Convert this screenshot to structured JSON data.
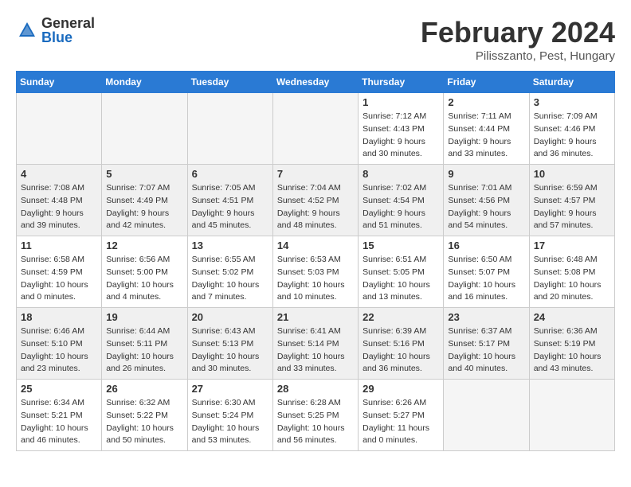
{
  "header": {
    "logo": {
      "general": "General",
      "blue": "Blue"
    },
    "title": "February 2024",
    "location": "Pilisszanto, Pest, Hungary"
  },
  "days_of_week": [
    "Sunday",
    "Monday",
    "Tuesday",
    "Wednesday",
    "Thursday",
    "Friday",
    "Saturday"
  ],
  "weeks": [
    [
      {
        "day": "",
        "info": ""
      },
      {
        "day": "",
        "info": ""
      },
      {
        "day": "",
        "info": ""
      },
      {
        "day": "",
        "info": ""
      },
      {
        "day": "1",
        "info": "Sunrise: 7:12 AM\nSunset: 4:43 PM\nDaylight: 9 hours\nand 30 minutes."
      },
      {
        "day": "2",
        "info": "Sunrise: 7:11 AM\nSunset: 4:44 PM\nDaylight: 9 hours\nand 33 minutes."
      },
      {
        "day": "3",
        "info": "Sunrise: 7:09 AM\nSunset: 4:46 PM\nDaylight: 9 hours\nand 36 minutes."
      }
    ],
    [
      {
        "day": "4",
        "info": "Sunrise: 7:08 AM\nSunset: 4:48 PM\nDaylight: 9 hours\nand 39 minutes."
      },
      {
        "day": "5",
        "info": "Sunrise: 7:07 AM\nSunset: 4:49 PM\nDaylight: 9 hours\nand 42 minutes."
      },
      {
        "day": "6",
        "info": "Sunrise: 7:05 AM\nSunset: 4:51 PM\nDaylight: 9 hours\nand 45 minutes."
      },
      {
        "day": "7",
        "info": "Sunrise: 7:04 AM\nSunset: 4:52 PM\nDaylight: 9 hours\nand 48 minutes."
      },
      {
        "day": "8",
        "info": "Sunrise: 7:02 AM\nSunset: 4:54 PM\nDaylight: 9 hours\nand 51 minutes."
      },
      {
        "day": "9",
        "info": "Sunrise: 7:01 AM\nSunset: 4:56 PM\nDaylight: 9 hours\nand 54 minutes."
      },
      {
        "day": "10",
        "info": "Sunrise: 6:59 AM\nSunset: 4:57 PM\nDaylight: 9 hours\nand 57 minutes."
      }
    ],
    [
      {
        "day": "11",
        "info": "Sunrise: 6:58 AM\nSunset: 4:59 PM\nDaylight: 10 hours\nand 0 minutes."
      },
      {
        "day": "12",
        "info": "Sunrise: 6:56 AM\nSunset: 5:00 PM\nDaylight: 10 hours\nand 4 minutes."
      },
      {
        "day": "13",
        "info": "Sunrise: 6:55 AM\nSunset: 5:02 PM\nDaylight: 10 hours\nand 7 minutes."
      },
      {
        "day": "14",
        "info": "Sunrise: 6:53 AM\nSunset: 5:03 PM\nDaylight: 10 hours\nand 10 minutes."
      },
      {
        "day": "15",
        "info": "Sunrise: 6:51 AM\nSunset: 5:05 PM\nDaylight: 10 hours\nand 13 minutes."
      },
      {
        "day": "16",
        "info": "Sunrise: 6:50 AM\nSunset: 5:07 PM\nDaylight: 10 hours\nand 16 minutes."
      },
      {
        "day": "17",
        "info": "Sunrise: 6:48 AM\nSunset: 5:08 PM\nDaylight: 10 hours\nand 20 minutes."
      }
    ],
    [
      {
        "day": "18",
        "info": "Sunrise: 6:46 AM\nSunset: 5:10 PM\nDaylight: 10 hours\nand 23 minutes."
      },
      {
        "day": "19",
        "info": "Sunrise: 6:44 AM\nSunset: 5:11 PM\nDaylight: 10 hours\nand 26 minutes."
      },
      {
        "day": "20",
        "info": "Sunrise: 6:43 AM\nSunset: 5:13 PM\nDaylight: 10 hours\nand 30 minutes."
      },
      {
        "day": "21",
        "info": "Sunrise: 6:41 AM\nSunset: 5:14 PM\nDaylight: 10 hours\nand 33 minutes."
      },
      {
        "day": "22",
        "info": "Sunrise: 6:39 AM\nSunset: 5:16 PM\nDaylight: 10 hours\nand 36 minutes."
      },
      {
        "day": "23",
        "info": "Sunrise: 6:37 AM\nSunset: 5:17 PM\nDaylight: 10 hours\nand 40 minutes."
      },
      {
        "day": "24",
        "info": "Sunrise: 6:36 AM\nSunset: 5:19 PM\nDaylight: 10 hours\nand 43 minutes."
      }
    ],
    [
      {
        "day": "25",
        "info": "Sunrise: 6:34 AM\nSunset: 5:21 PM\nDaylight: 10 hours\nand 46 minutes."
      },
      {
        "day": "26",
        "info": "Sunrise: 6:32 AM\nSunset: 5:22 PM\nDaylight: 10 hours\nand 50 minutes."
      },
      {
        "day": "27",
        "info": "Sunrise: 6:30 AM\nSunset: 5:24 PM\nDaylight: 10 hours\nand 53 minutes."
      },
      {
        "day": "28",
        "info": "Sunrise: 6:28 AM\nSunset: 5:25 PM\nDaylight: 10 hours\nand 56 minutes."
      },
      {
        "day": "29",
        "info": "Sunrise: 6:26 AM\nSunset: 5:27 PM\nDaylight: 11 hours\nand 0 minutes."
      },
      {
        "day": "",
        "info": ""
      },
      {
        "day": "",
        "info": ""
      }
    ]
  ]
}
